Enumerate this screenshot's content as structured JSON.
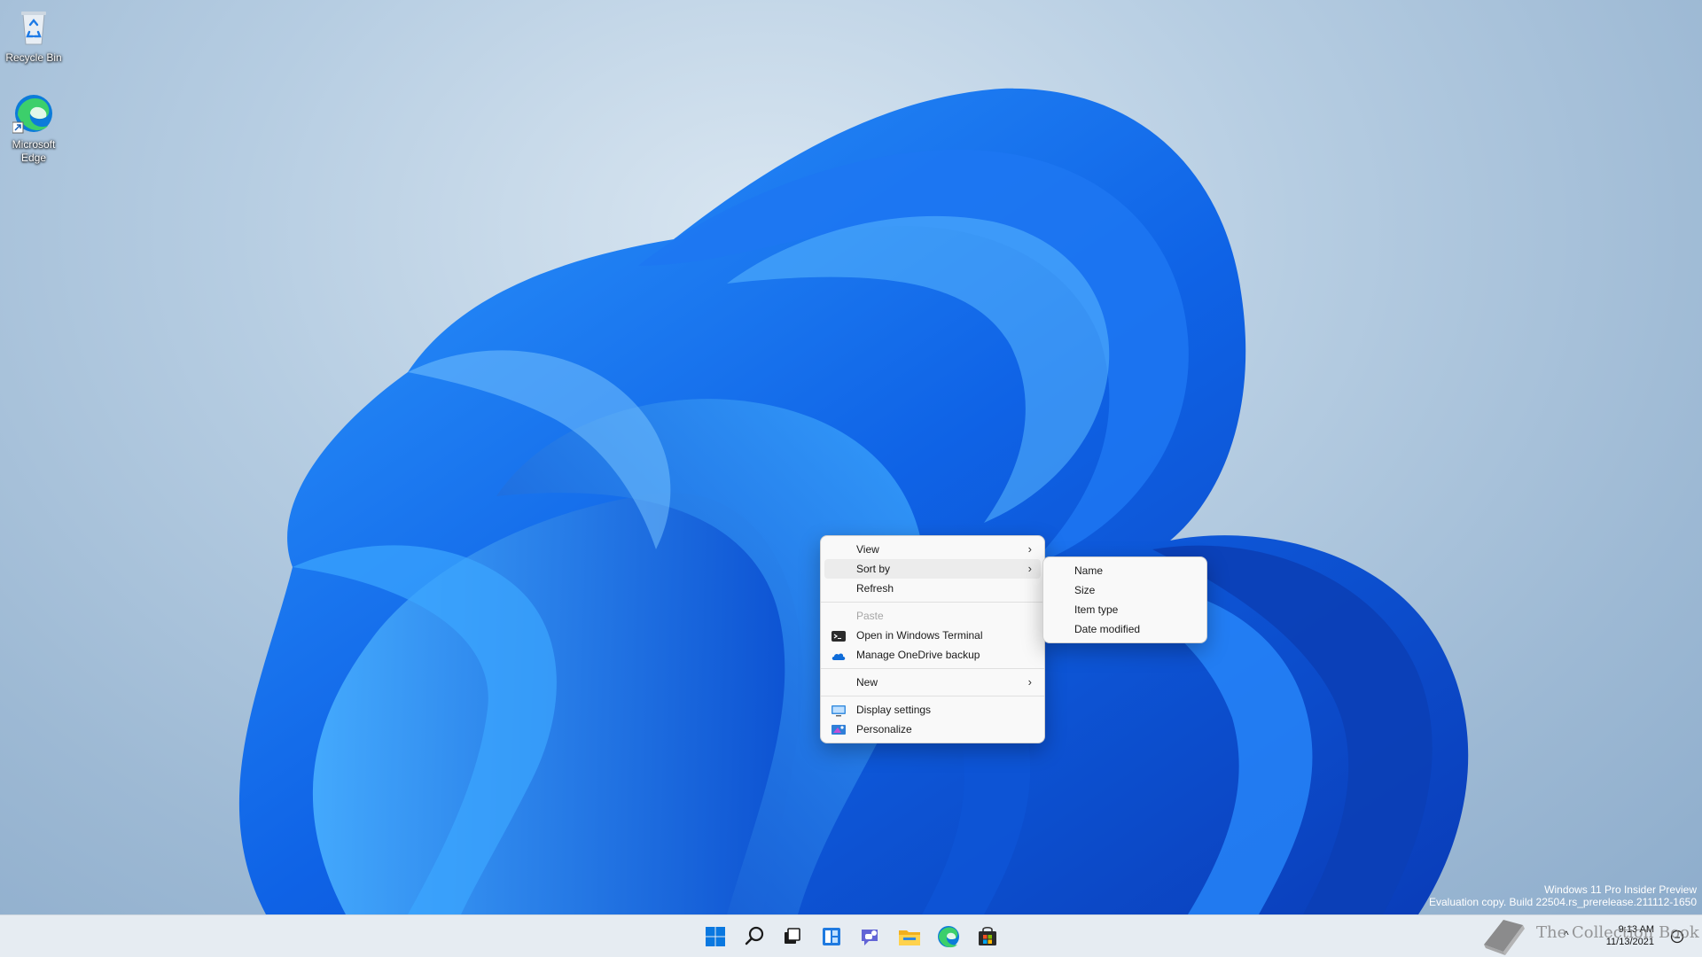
{
  "desktop": {
    "icons": [
      {
        "label": "Recycle Bin",
        "icon": "recycle-bin-icon"
      },
      {
        "label": "Microsoft Edge",
        "icon": "edge-icon"
      }
    ]
  },
  "context_menu": {
    "items": [
      {
        "label": "View",
        "has_submenu": true
      },
      {
        "label": "Sort by",
        "has_submenu": true,
        "hovered": true
      },
      {
        "label": "Refresh"
      },
      {
        "label": "Paste",
        "disabled": true
      },
      {
        "label": "Open in Windows Terminal",
        "icon": "terminal-icon"
      },
      {
        "label": "Manage OneDrive backup",
        "icon": "onedrive-icon"
      },
      {
        "label": "New",
        "has_submenu": true
      },
      {
        "label": "Display settings",
        "icon": "display-icon"
      },
      {
        "label": "Personalize",
        "icon": "personalize-icon"
      }
    ],
    "chevron": "›"
  },
  "sort_submenu": {
    "items": [
      {
        "label": "Name"
      },
      {
        "label": "Size"
      },
      {
        "label": "Item type"
      },
      {
        "label": "Date modified"
      }
    ]
  },
  "watermark": {
    "line1": "Windows 11 Pro Insider Preview",
    "line2": "Evaluation copy. Build 22504.rs_prerelease.211112-1650"
  },
  "taskbar": {
    "apps": [
      "start-icon",
      "search-icon",
      "task-view-icon",
      "widgets-icon",
      "chat-icon",
      "file-explorer-icon",
      "edge-icon",
      "store-icon"
    ],
    "tray_arrow": "^",
    "time": "9:13 AM",
    "date": "11/13/2021"
  },
  "overlay": {
    "text": "The Collection Book"
  },
  "colors": {
    "accent": "#0a5fd8",
    "menu_bg": "#f9f9f9",
    "taskbar_bg": "#e6ecf2"
  }
}
